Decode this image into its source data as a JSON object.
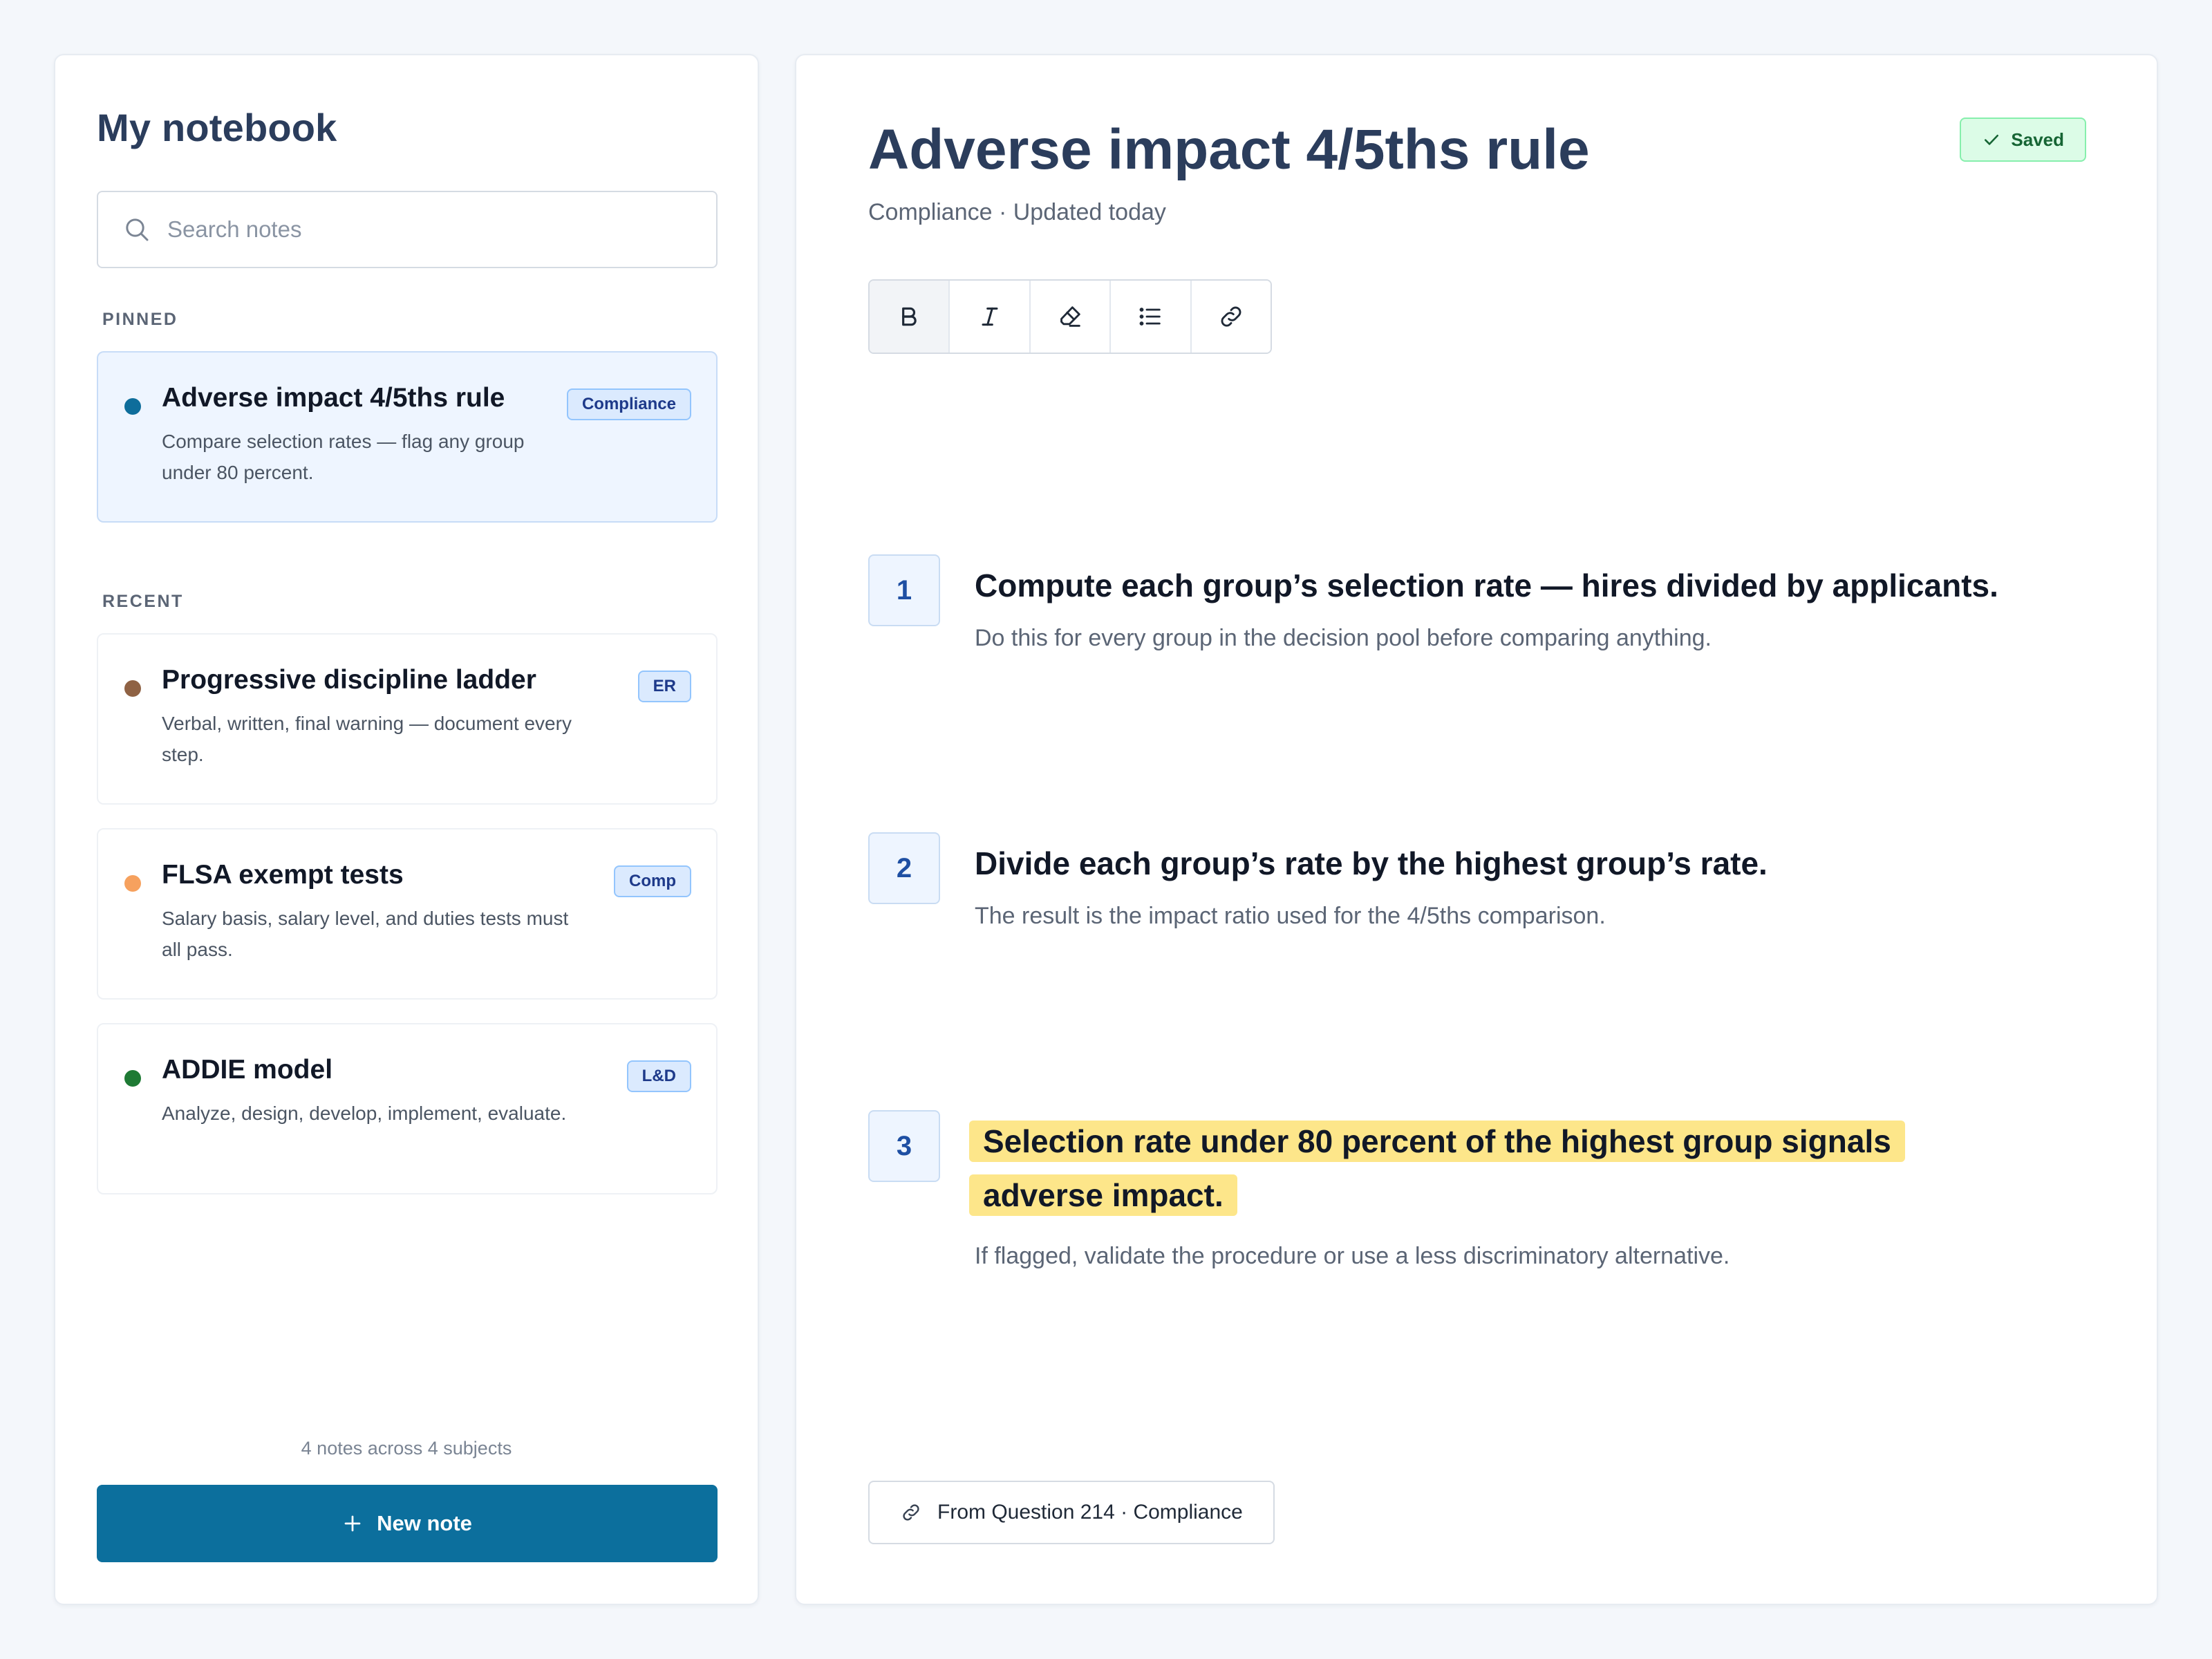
{
  "sidebar": {
    "title": "My notebook",
    "search": {
      "placeholder": "Search notes",
      "value": ""
    },
    "pinned_label": "PINNED",
    "recent_label": "RECENT",
    "pinned": [
      {
        "title": "Adverse impact 4/5ths rule",
        "description": "Compare selection rates — flag any group under 80 percent.",
        "tag": "Compliance",
        "dot_color": "#0e6d9b"
      }
    ],
    "recent": [
      {
        "title": "Progressive discipline ladder",
        "description": "Verbal, written, final warning — document every step.",
        "tag": "ER",
        "dot_color": "#8f6244"
      },
      {
        "title": "FLSA exempt tests",
        "description": "Salary basis, salary level, and duties tests must all pass.",
        "tag": "Comp",
        "dot_color": "#f6a15e"
      },
      {
        "title": "ADDIE model",
        "description": "Analyze, design, develop, implement, evaluate.",
        "tag": "L&D",
        "dot_color": "#1e7a34"
      }
    ],
    "footer_count": "4 notes across 4 subjects",
    "new_note_label": "New note"
  },
  "main": {
    "title": "Adverse impact 4/5ths rule",
    "meta": "Compliance · Updated today",
    "saved_label": "Saved",
    "toolbar": [
      {
        "icon": "bold-icon"
      },
      {
        "icon": "italic-icon"
      },
      {
        "icon": "highlighter-icon"
      },
      {
        "icon": "list-icon"
      },
      {
        "icon": "link-icon"
      }
    ],
    "steps": [
      {
        "number": "1",
        "title": "Compute each group’s selection rate — hires divided by applicants.",
        "description": "Do this for every group in the decision pool before comparing anything.",
        "highlighted": false
      },
      {
        "number": "2",
        "title": "Divide each group’s rate by the highest group’s rate.",
        "description": "The result is the impact ratio used for the 4/5ths comparison.",
        "highlighted": false
      },
      {
        "number": "3",
        "title": "Selection rate under 80 percent of the highest group signals adverse impact.",
        "description": "If flagged, validate the procedure or use a less discriminatory alternative.",
        "highlighted": true
      }
    ],
    "source_label": "From Question 214 · Compliance"
  },
  "colors": {
    "accent": "#0c6f9d",
    "highlight": "#fde68a",
    "saved_green": "#166534",
    "tag_blue": "#1e3a8a"
  }
}
